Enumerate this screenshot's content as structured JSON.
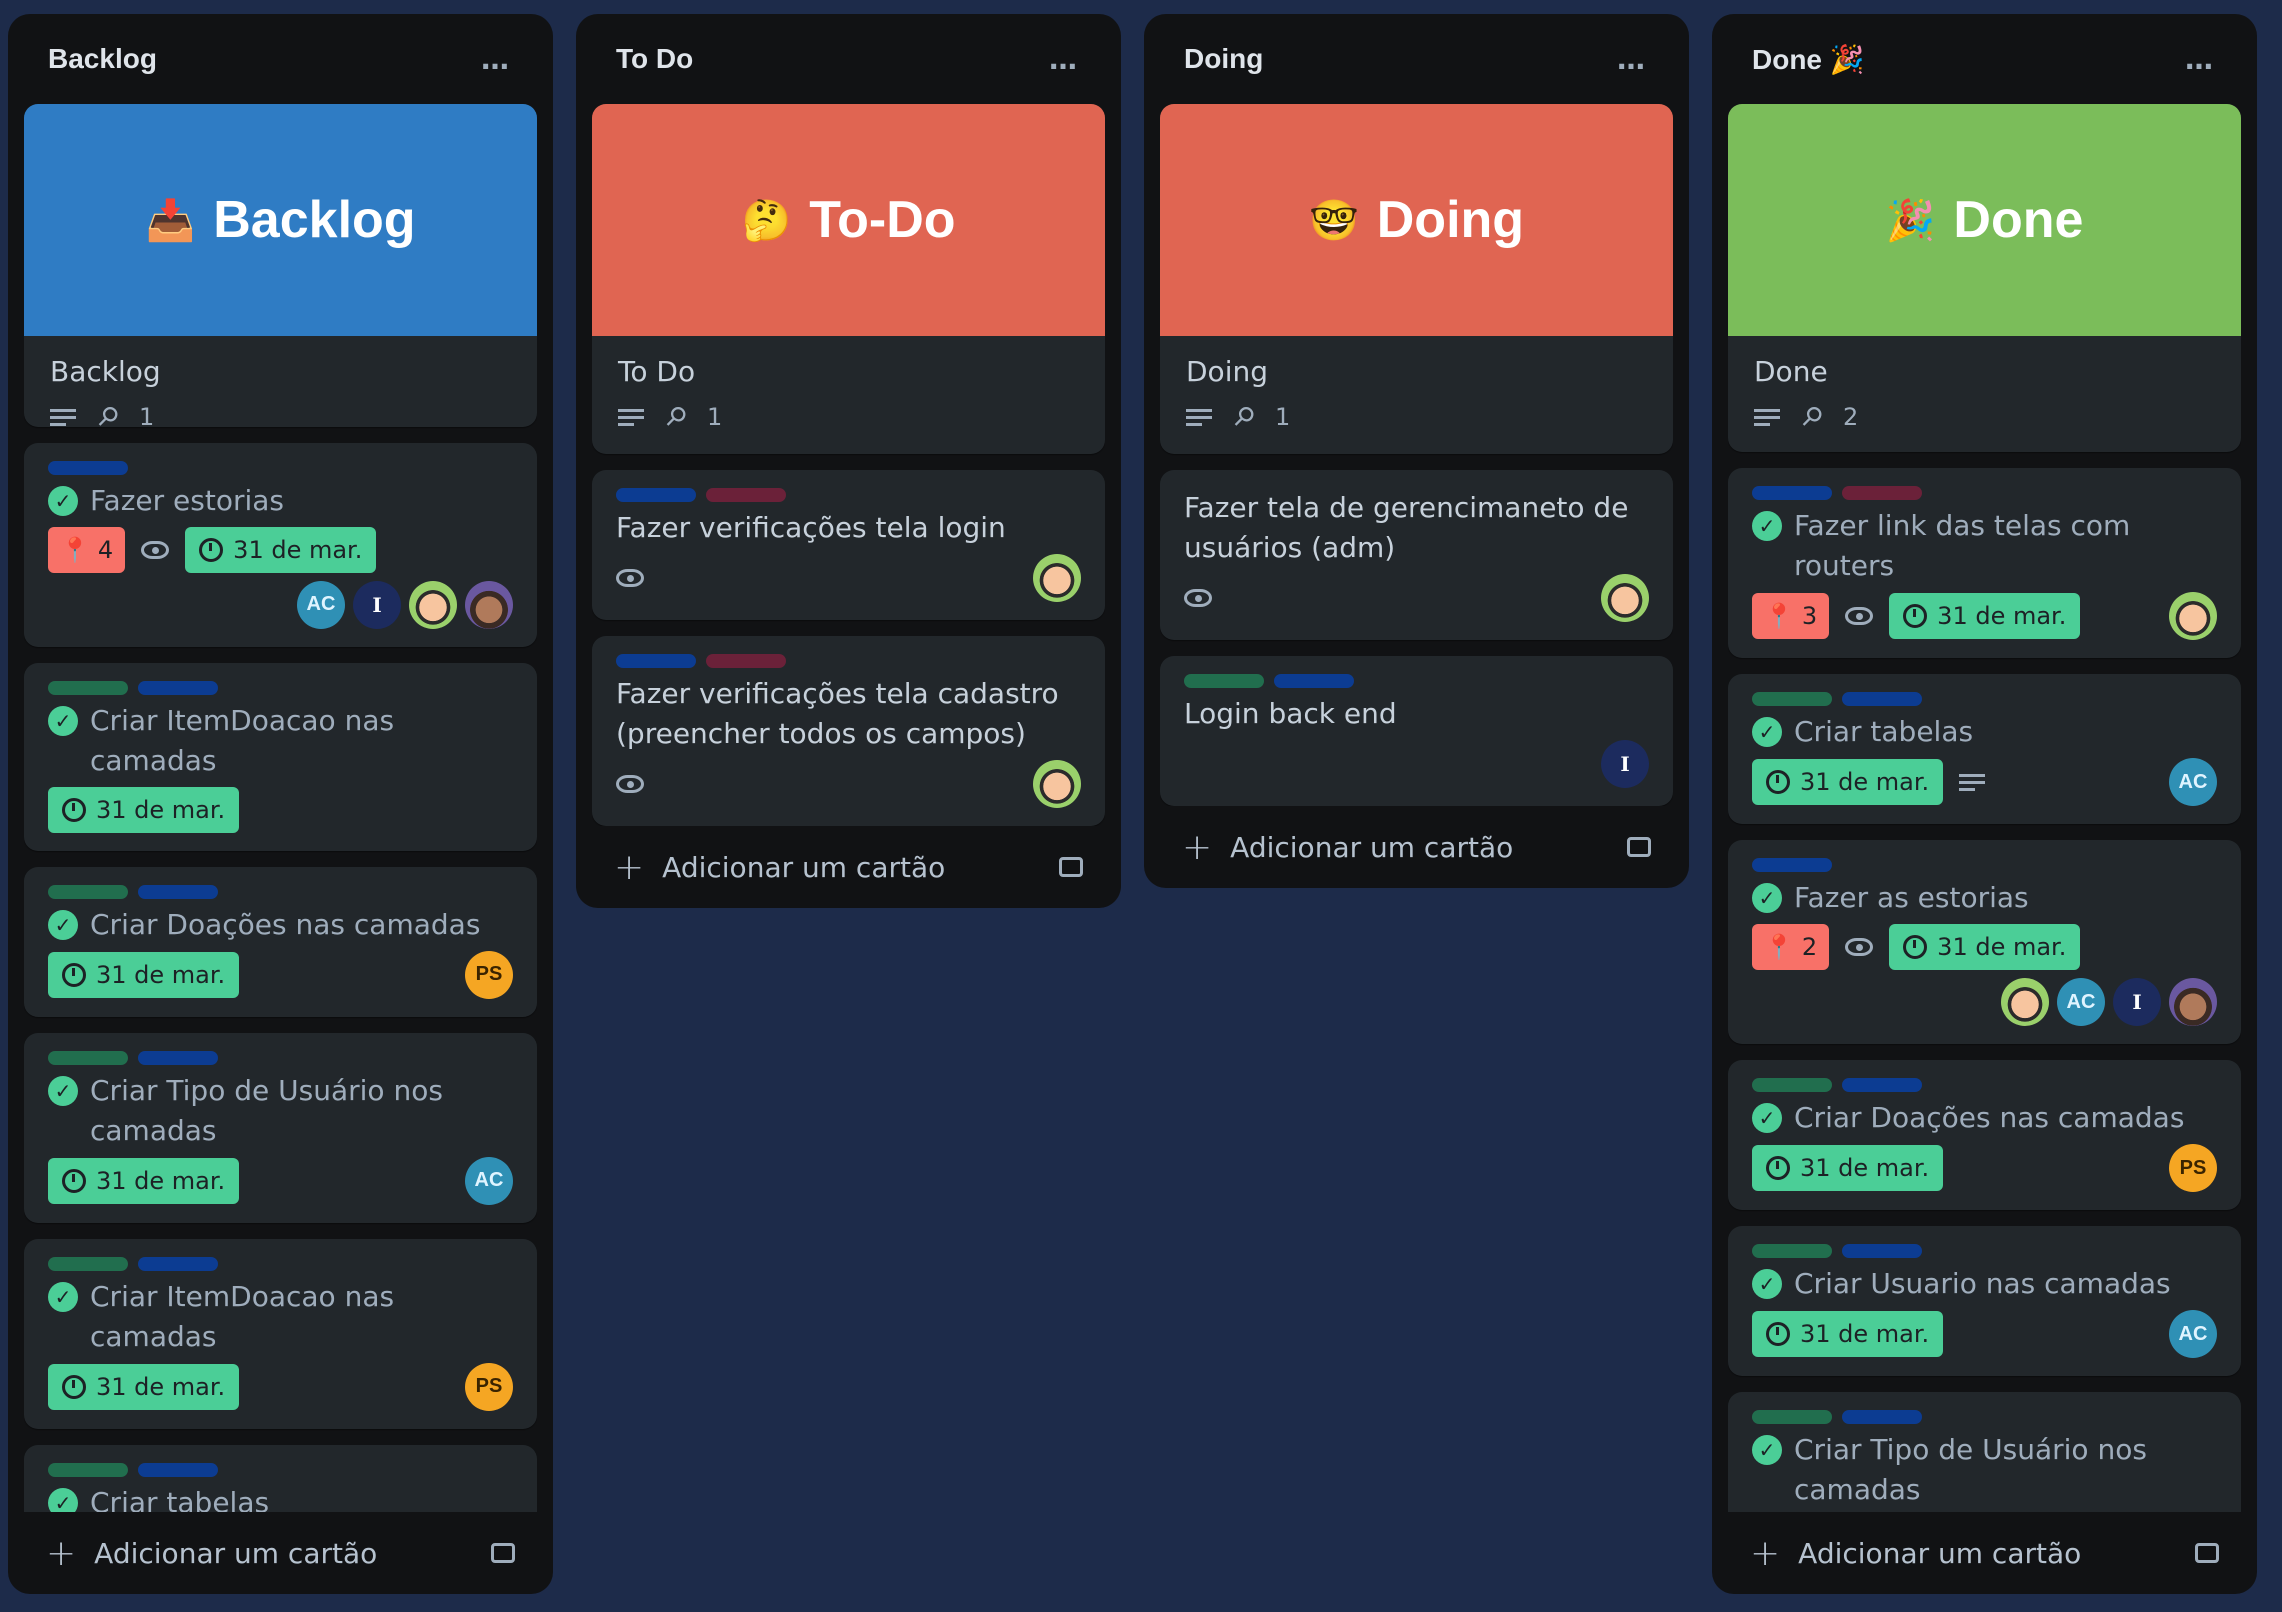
{
  "colors": {
    "board_bg": "#1d2b4a",
    "list_bg": "#111214",
    "card_bg": "#22272b",
    "label_green": "#216e4e",
    "label_blue": "#0c3c92",
    "label_red": "#6b2139",
    "backlog_cover": "#2f7cc4",
    "todo_cover": "#e06552",
    "doing_cover": "#e06552",
    "done_cover": "#7bbd5a"
  },
  "add_card_label": "Adicionar um cartão",
  "menu_icon": "…",
  "lists": {
    "backlog": {
      "title": "Backlog",
      "cover": {
        "emoji": "📥",
        "text": "Backlog",
        "card_title": "Backlog",
        "attachments": "1"
      },
      "cards": [
        {
          "title": "Fazer estorias",
          "votes": "4",
          "date": "31 de mar."
        },
        {
          "title": "Criar ItemDoacao nas camadas",
          "date": "31 de mar."
        },
        {
          "title": "Criar Doações nas camadas",
          "date": "31 de mar.",
          "avatar": "PS"
        },
        {
          "title": "Criar Tipo de Usuário nos camadas",
          "date": "31 de mar.",
          "avatar": "AC"
        },
        {
          "title": "Criar ItemDoacao nas camadas",
          "date": "31 de mar.",
          "avatar": "PS"
        },
        {
          "title": "Criar tabelas"
        }
      ],
      "avatars_card1": [
        "AC",
        "I"
      ]
    },
    "todo": {
      "title": "To Do",
      "cover": {
        "emoji": "🤔",
        "text": "To-Do",
        "card_title": "To Do",
        "attachments": "1"
      },
      "cards": [
        {
          "title": "Fazer verificações tela login"
        },
        {
          "title": "Fazer verificações tela cadastro (preencher todos os campos)"
        }
      ]
    },
    "doing": {
      "title": "Doing",
      "cover": {
        "emoji": "🤓",
        "text": "Doing",
        "card_title": "Doing",
        "attachments": "1"
      },
      "cards": [
        {
          "title": "Fazer tela de gerencimaneto de usuários (adm)"
        },
        {
          "title": "Login back end",
          "avatar": "I"
        }
      ]
    },
    "done": {
      "title": "Done 🎉",
      "cover": {
        "emoji": "🎉",
        "text": "Done",
        "card_title": "Done",
        "attachments": "2"
      },
      "cards": [
        {
          "title": "Fazer link das telas com routers",
          "votes": "3",
          "date": "31 de mar."
        },
        {
          "title": "Criar tabelas",
          "date": "31 de mar.",
          "avatar": "AC"
        },
        {
          "title": "Fazer as estorias",
          "votes": "2",
          "date": "31 de mar."
        },
        {
          "title": "Criar Doações nas camadas",
          "date": "31 de mar.",
          "avatar": "PS"
        },
        {
          "title": "Criar Usuario nas camadas",
          "date": "31 de mar.",
          "avatar": "AC"
        },
        {
          "title": "Criar Tipo de Usuário nos camadas"
        }
      ],
      "avatars_card3": [
        "AC",
        "I"
      ]
    }
  }
}
